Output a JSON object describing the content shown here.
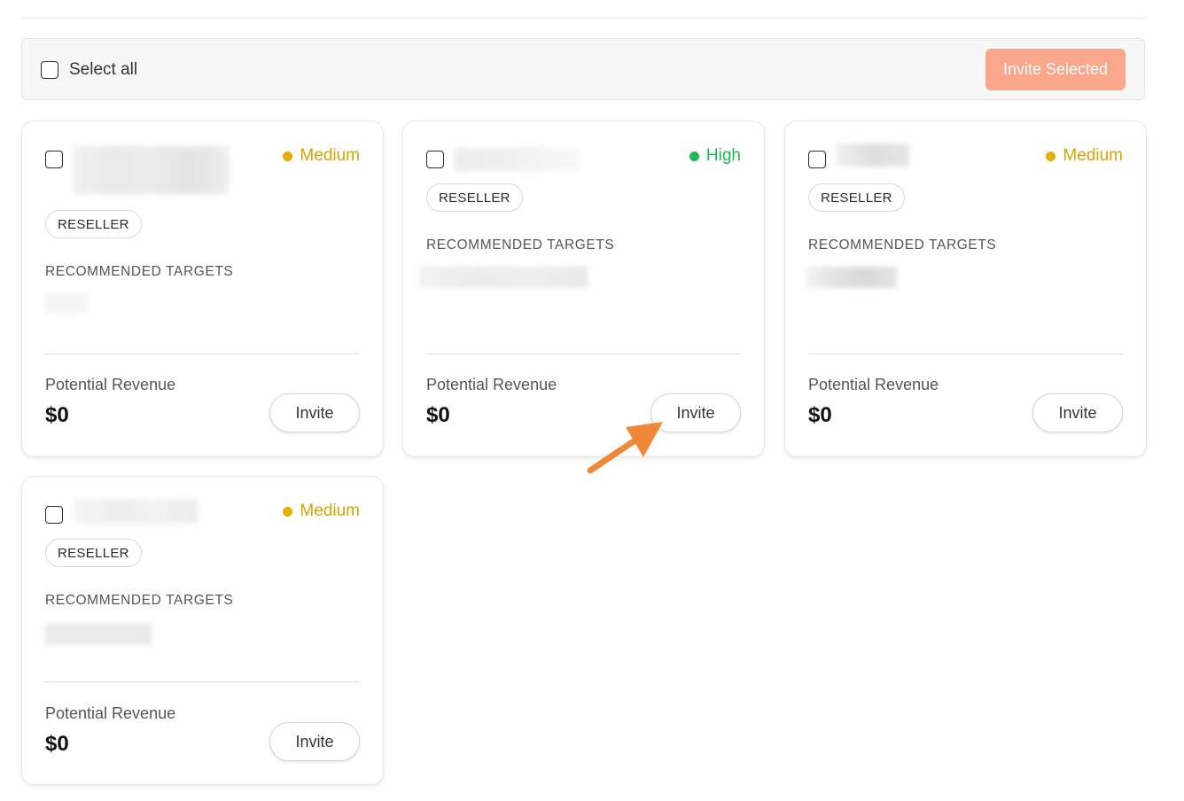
{
  "toolbar": {
    "select_all_label": "Select all",
    "invite_selected_label": "Invite Selected"
  },
  "colors": {
    "medium": "#d9a300",
    "high": "#1db954",
    "accent_disabled": "#fba78b",
    "arrow": "#f0883a"
  },
  "cards": [
    {
      "priority": "Medium",
      "tag": "RESELLER",
      "rec_label": "RECOMMENDED TARGETS",
      "revenue_label": "Potential Revenue",
      "revenue": "$0",
      "invite_label": "Invite"
    },
    {
      "priority": "High",
      "tag": "RESELLER",
      "rec_label": "RECOMMENDED TARGETS",
      "revenue_label": "Potential Revenue",
      "revenue": "$0",
      "invite_label": "Invite"
    },
    {
      "priority": "Medium",
      "tag": "RESELLER",
      "rec_label": "RECOMMENDED TARGETS",
      "revenue_label": "Potential Revenue",
      "revenue": "$0",
      "invite_label": "Invite"
    },
    {
      "priority": "Medium",
      "tag": "RESELLER",
      "rec_label": "RECOMMENDED TARGETS",
      "revenue_label": "Potential Revenue",
      "revenue": "$0",
      "invite_label": "Invite"
    }
  ]
}
